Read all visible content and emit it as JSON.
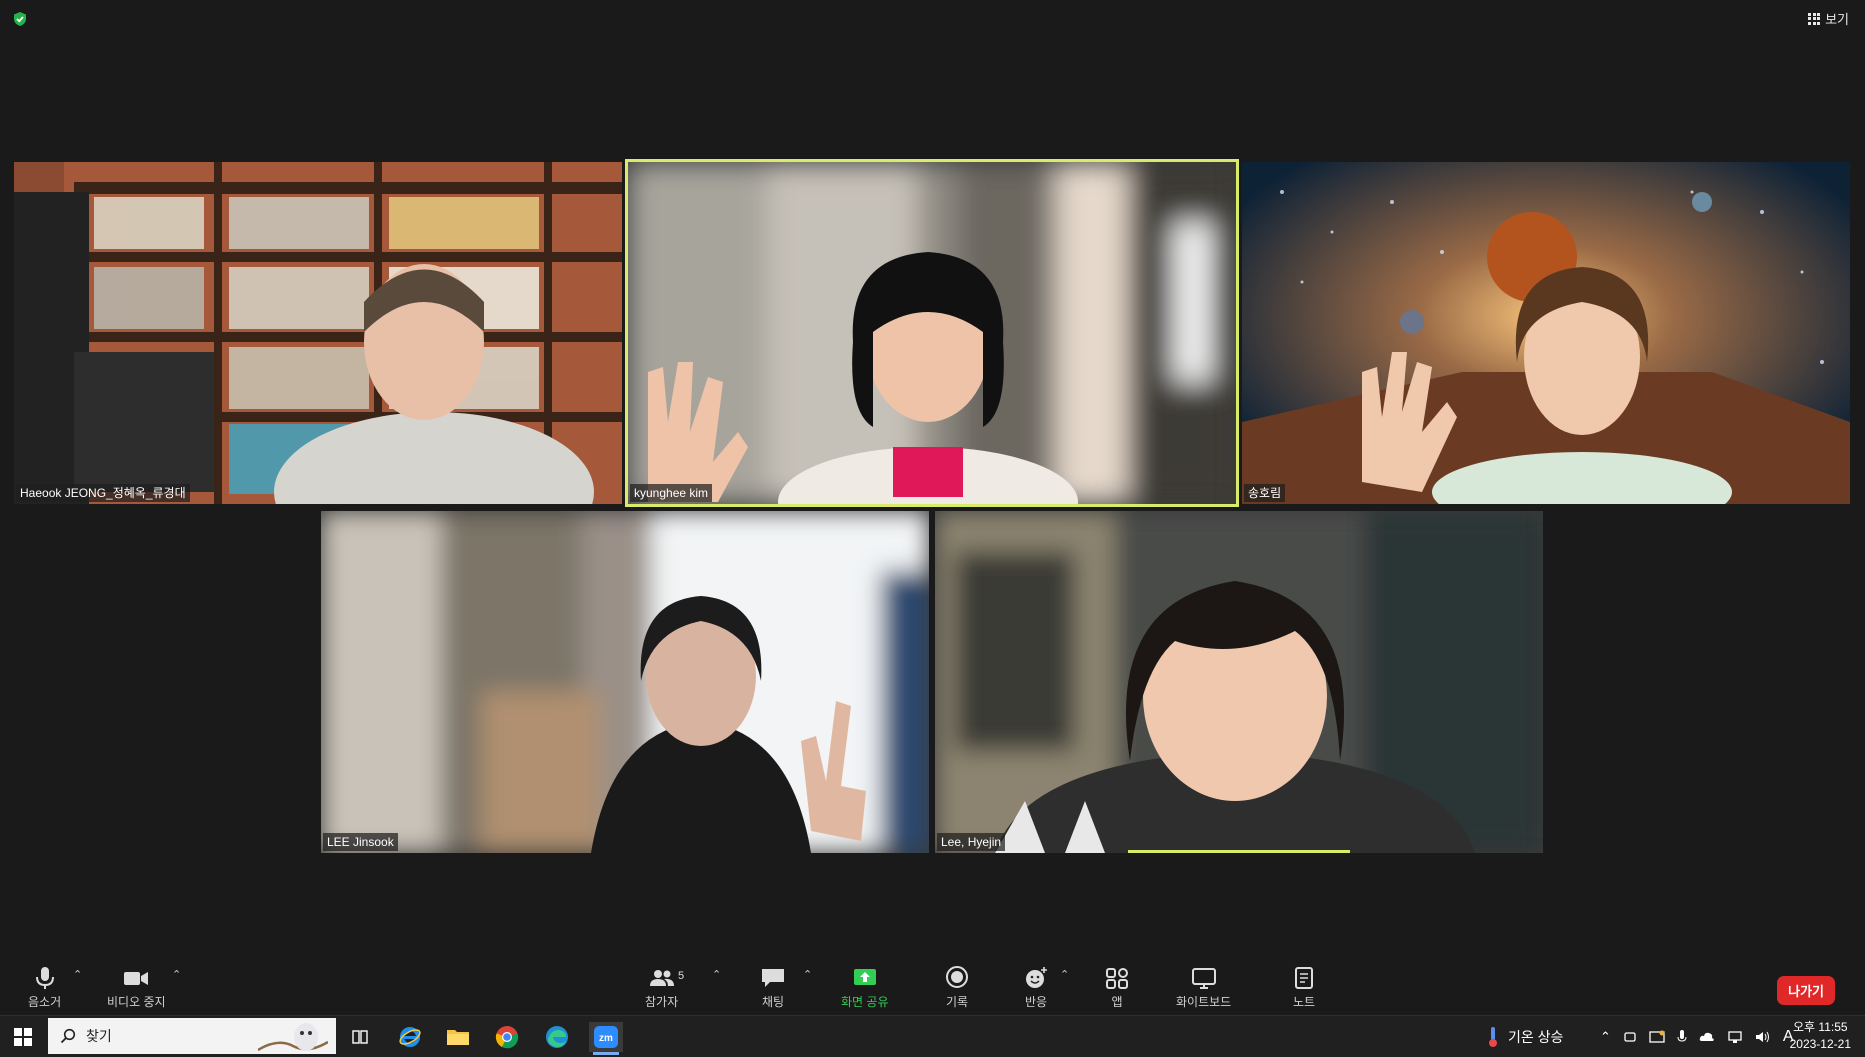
{
  "header": {
    "view_label": "보기"
  },
  "participants": [
    {
      "name": "Haeook JEONG_정혜옥_류경대",
      "active": false
    },
    {
      "name": "kyunghee kim",
      "active": true
    },
    {
      "name": "송호림",
      "active": false
    },
    {
      "name": "LEE Jinsook",
      "active": false
    },
    {
      "name": "Lee, Hyejin",
      "active": false
    }
  ],
  "toolbar": {
    "mute_label": "음소거",
    "video_label": "비디오 중지",
    "participants_label": "참가자",
    "participants_count": "5",
    "chat_label": "채팅",
    "share_label": "화면 공유",
    "record_label": "기록",
    "reactions_label": "반응",
    "apps_label": "앱",
    "whiteboard_label": "화이트보드",
    "notes_label": "노트",
    "leave_label": "나가기",
    "share_color": "#33cc55",
    "leave_color": "#e02828",
    "active_speaker_color": "#d8ec6a"
  },
  "taskbar": {
    "search_placeholder": "찾기",
    "weather_text": "기온 상승",
    "ime_label": "A",
    "time": "오후 11:55",
    "date": "2023-12-21"
  }
}
